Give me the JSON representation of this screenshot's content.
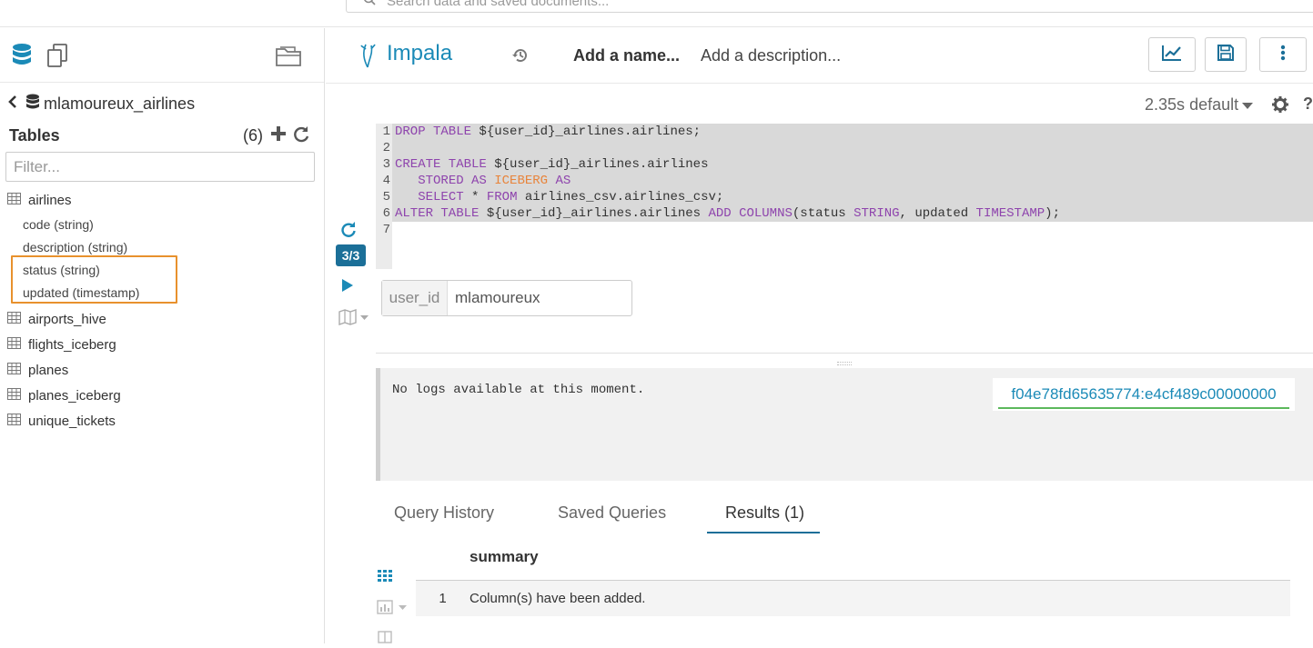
{
  "topbar": {
    "search_placeholder": "Search data and saved documents..."
  },
  "left_panel": {
    "database_name": "mlamoureux_airlines",
    "tables_label": "Tables",
    "tables_count": "(6)",
    "filter_placeholder": "Filter...",
    "tables": [
      {
        "name": "airlines",
        "columns": [
          "code (string)",
          "description (string)",
          "status (string)",
          "updated (timestamp)"
        ]
      },
      {
        "name": "airports_hive"
      },
      {
        "name": "flights_iceberg"
      },
      {
        "name": "planes"
      },
      {
        "name": "planes_iceberg"
      },
      {
        "name": "unique_tickets"
      }
    ],
    "highlight_color": "#e8912d"
  },
  "editor_header": {
    "engine": "Impala",
    "name_placeholder": "Add a name...",
    "description_placeholder": "Add a description...",
    "timing": "2.35s",
    "database": "default",
    "help": "?"
  },
  "editor": {
    "line_numbers": [
      "1",
      "2",
      "3",
      "4",
      "5",
      "6",
      "7"
    ],
    "statement_counter": "3/3",
    "code": {
      "l1_kw": "DROP TABLE",
      "l1_rest": " ${user_id}_airlines.airlines;",
      "l3_kw": "CREATE TABLE",
      "l3_rest": " ${user_id}_airlines.airlines",
      "l4_indent": "   ",
      "l4_kw": "STORED AS",
      "l4_kw2": "ICEBERG",
      "l4_kw3": "AS",
      "l5_indent": "   ",
      "l5_kw": "SELECT",
      "l5_mid": " * ",
      "l5_kw2": "FROM",
      "l5_rest": " airlines_csv.airlines_csv;",
      "l6_kw": "ALTER TABLE",
      "l6_mid": " ${user_id}_airlines.airlines ",
      "l6_kw2": "ADD COLUMNS",
      "l6_mid2": "(status ",
      "l6_kw3": "STRING",
      "l6_mid3": ", updated ",
      "l6_kw4": "TIMESTAMP",
      "l6_end": ");"
    },
    "param_name": "user_id",
    "param_value": "mlamoureux"
  },
  "logs": {
    "message": "No logs available at this moment.",
    "query_id": "f04e78fd65635774:e4cf489c00000000"
  },
  "tabs": [
    {
      "label": "Query History"
    },
    {
      "label": "Saved Queries"
    },
    {
      "label": "Results (1)",
      "active": true
    }
  ],
  "results": {
    "header": "summary",
    "rows": [
      {
        "index": "1",
        "value": "Column(s) have been added."
      }
    ]
  },
  "colors": {
    "accent": "#1b8ab7",
    "keyword": "#8e44ad",
    "iceberg_keyword": "#e8843b",
    "badge": "#1b6f98"
  }
}
